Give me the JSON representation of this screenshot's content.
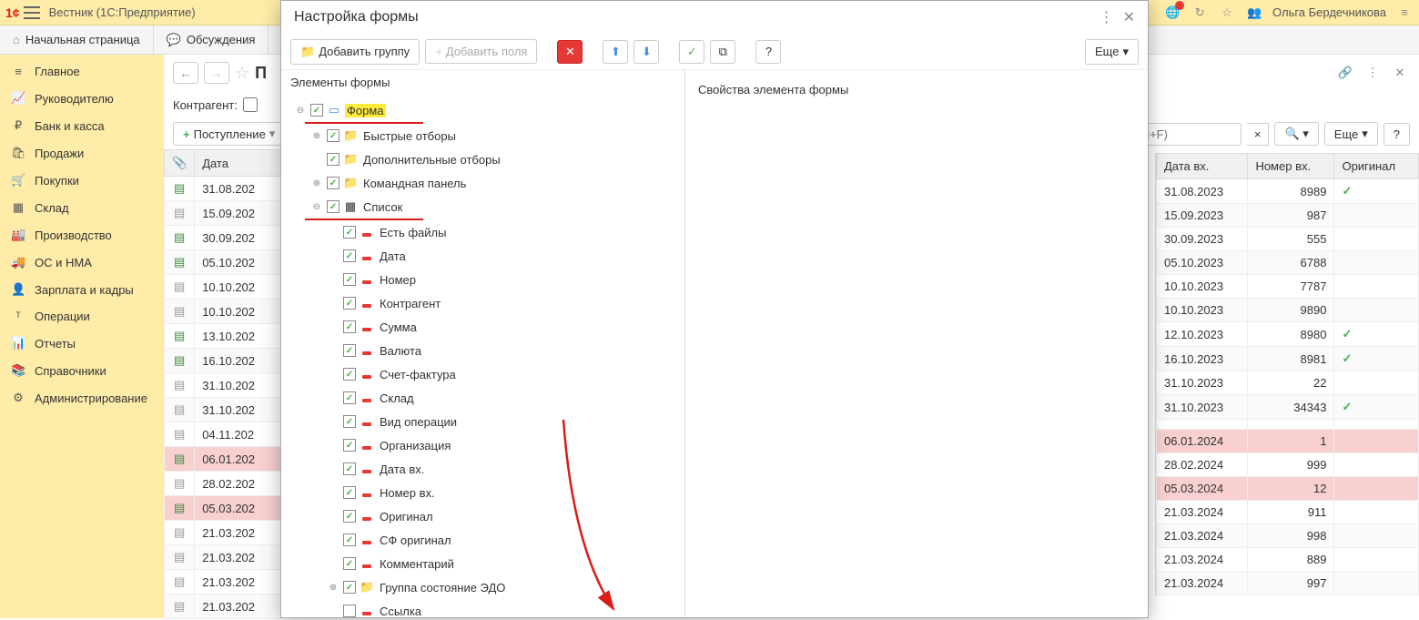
{
  "topbar": {
    "app_title": "Вестник  (1С:Предприятие)",
    "user": "Ольга Бердечникова"
  },
  "tabs": [
    {
      "icon": "home",
      "label": "Начальная страница"
    },
    {
      "icon": "chat",
      "label": "Обсуждения"
    }
  ],
  "sidebar": [
    {
      "icon": "≡",
      "label": "Главное"
    },
    {
      "icon": "📈",
      "label": "Руководителю"
    },
    {
      "icon": "₽",
      "label": "Банк и касса"
    },
    {
      "icon": "🛍",
      "label": "Продажи"
    },
    {
      "icon": "🛒",
      "label": "Покупки"
    },
    {
      "icon": "▦",
      "label": "Склад"
    },
    {
      "icon": "🏭",
      "label": "Производство"
    },
    {
      "icon": "🚚",
      "label": "ОС и НМА"
    },
    {
      "icon": "👤",
      "label": "Зарплата и кадры"
    },
    {
      "icon": "ᵀ",
      "label": "Операции"
    },
    {
      "icon": "📊",
      "label": "Отчеты"
    },
    {
      "icon": "📚",
      "label": "Справочники"
    },
    {
      "icon": "⚙",
      "label": "Администрирование"
    }
  ],
  "main": {
    "page_title_partial": "П",
    "filter_label": "Контрагент:",
    "toolbar_add": "Поступление",
    "search_placeholder": "Ctrl+F)",
    "more_btn": "Еще",
    "help_btn": "?",
    "columns": {
      "attach": "📎",
      "date": "Дата"
    },
    "rows": [
      {
        "sent": true,
        "date": "31.08.202",
        "pink": false
      },
      {
        "sent": false,
        "date": "15.09.202",
        "pink": false
      },
      {
        "sent": true,
        "date": "30.09.202",
        "pink": false
      },
      {
        "sent": true,
        "date": "05.10.202",
        "pink": false
      },
      {
        "sent": false,
        "date": "10.10.202",
        "pink": false
      },
      {
        "sent": false,
        "date": "10.10.202",
        "pink": false
      },
      {
        "sent": true,
        "date": "13.10.202",
        "pink": false
      },
      {
        "sent": true,
        "date": "16.10.202",
        "pink": false
      },
      {
        "sent": false,
        "date": "31.10.202",
        "pink": false
      },
      {
        "sent": false,
        "date": "31.10.202",
        "pink": false
      },
      {
        "sent": false,
        "date": "04.11.202",
        "pink": false
      },
      {
        "sent": true,
        "date": "06.01.202",
        "pink": true
      },
      {
        "sent": false,
        "date": "28.02.202",
        "pink": false
      },
      {
        "sent": true,
        "date": "05.03.202",
        "pink": true
      },
      {
        "sent": false,
        "date": "21.03.202",
        "pink": false
      },
      {
        "sent": false,
        "date": "21.03.202",
        "pink": false
      },
      {
        "sent": false,
        "date": "21.03.202",
        "pink": false
      },
      {
        "sent": false,
        "date": "21.03.202",
        "pink": false
      }
    ]
  },
  "right_table": {
    "columns": {
      "date_in": "Дата вх.",
      "num_in": "Номер вх.",
      "orig": "Оригинал"
    },
    "rows": [
      {
        "date": "31.08.2023",
        "num": "8989",
        "orig": true,
        "pink": false
      },
      {
        "date": "15.09.2023",
        "num": "987",
        "orig": false,
        "pink": false
      },
      {
        "date": "30.09.2023",
        "num": "555",
        "orig": false,
        "pink": false
      },
      {
        "date": "05.10.2023",
        "num": "6788",
        "orig": false,
        "pink": false
      },
      {
        "date": "10.10.2023",
        "num": "7787",
        "orig": false,
        "pink": false
      },
      {
        "date": "10.10.2023",
        "num": "9890",
        "orig": false,
        "pink": false
      },
      {
        "date": "12.10.2023",
        "num": "8980",
        "orig": true,
        "pink": false
      },
      {
        "date": "16.10.2023",
        "num": "8981",
        "orig": true,
        "pink": false
      },
      {
        "date": "31.10.2023",
        "num": "22",
        "orig": false,
        "pink": false
      },
      {
        "date": "31.10.2023",
        "num": "34343",
        "orig": true,
        "pink": false
      },
      {
        "date": "",
        "num": "",
        "orig": false,
        "pink": false
      },
      {
        "date": "06.01.2024",
        "num": "1",
        "orig": false,
        "pink": true
      },
      {
        "date": "28.02.2024",
        "num": "999",
        "orig": false,
        "pink": false
      },
      {
        "date": "05.03.2024",
        "num": "12",
        "orig": false,
        "pink": true
      },
      {
        "date": "21.03.2024",
        "num": "911",
        "orig": false,
        "pink": false
      },
      {
        "date": "21.03.2024",
        "num": "998",
        "orig": false,
        "pink": false
      },
      {
        "date": "21.03.2024",
        "num": "889",
        "orig": false,
        "pink": false
      },
      {
        "date": "21.03.2024",
        "num": "997",
        "orig": false,
        "pink": false
      }
    ]
  },
  "dialog": {
    "title": "Настройка формы",
    "btn_add_group": "Добавить группу",
    "btn_add_fields": "Добавить поля",
    "btn_more": "Еще",
    "left_title": "Элементы формы",
    "right_title": "Свойства элемента формы",
    "tree": [
      {
        "depth": 0,
        "toggle": "−",
        "checked": true,
        "icon": "form",
        "label": "Форма",
        "hl": true,
        "underline": true
      },
      {
        "depth": 1,
        "toggle": "+",
        "checked": true,
        "icon": "folder",
        "label": "Быстрые отборы"
      },
      {
        "depth": 1,
        "toggle": "",
        "checked": true,
        "icon": "folder",
        "label": "Дополнительные отборы"
      },
      {
        "depth": 1,
        "toggle": "+",
        "checked": true,
        "icon": "folder",
        "label": "Командная панель"
      },
      {
        "depth": 1,
        "toggle": "−",
        "checked": true,
        "icon": "list",
        "label": "Список",
        "underline": true
      },
      {
        "depth": 2,
        "toggle": "",
        "checked": true,
        "icon": "field",
        "label": "Есть файлы"
      },
      {
        "depth": 2,
        "toggle": "",
        "checked": true,
        "icon": "field",
        "label": "Дата"
      },
      {
        "depth": 2,
        "toggle": "",
        "checked": true,
        "icon": "field",
        "label": "Номер"
      },
      {
        "depth": 2,
        "toggle": "",
        "checked": true,
        "icon": "field",
        "label": "Контрагент"
      },
      {
        "depth": 2,
        "toggle": "",
        "checked": true,
        "icon": "field",
        "label": "Сумма"
      },
      {
        "depth": 2,
        "toggle": "",
        "checked": true,
        "icon": "field",
        "label": "Валюта"
      },
      {
        "depth": 2,
        "toggle": "",
        "checked": true,
        "icon": "field",
        "label": "Счет-фактура"
      },
      {
        "depth": 2,
        "toggle": "",
        "checked": true,
        "icon": "field",
        "label": "Склад"
      },
      {
        "depth": 2,
        "toggle": "",
        "checked": true,
        "icon": "field",
        "label": "Вид операции"
      },
      {
        "depth": 2,
        "toggle": "",
        "checked": true,
        "icon": "field",
        "label": "Организация"
      },
      {
        "depth": 2,
        "toggle": "",
        "checked": true,
        "icon": "field",
        "label": "Дата вх."
      },
      {
        "depth": 2,
        "toggle": "",
        "checked": true,
        "icon": "field",
        "label": "Номер вх."
      },
      {
        "depth": 2,
        "toggle": "",
        "checked": true,
        "icon": "field",
        "label": "Оригинал"
      },
      {
        "depth": 2,
        "toggle": "",
        "checked": true,
        "icon": "field",
        "label": "СФ оригинал"
      },
      {
        "depth": 2,
        "toggle": "",
        "checked": true,
        "icon": "field",
        "label": "Комментарий"
      },
      {
        "depth": 2,
        "toggle": "+",
        "checked": true,
        "icon": "folder",
        "label": "Группа состояние ЭДО"
      },
      {
        "depth": 2,
        "toggle": "",
        "checked": false,
        "icon": "field",
        "label": "Ссылка"
      }
    ]
  }
}
